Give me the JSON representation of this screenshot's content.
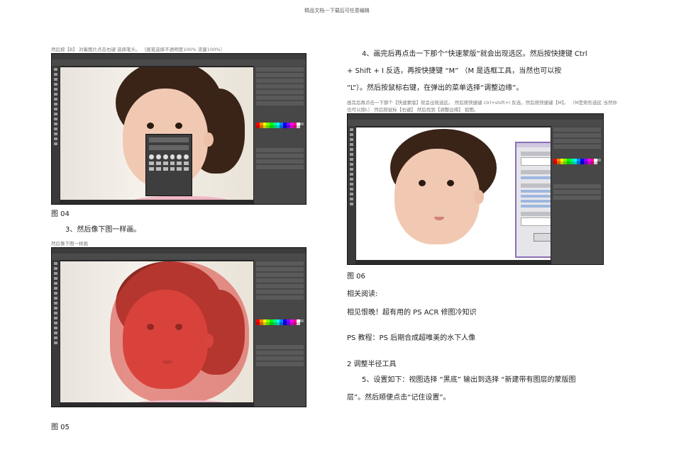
{
  "header_note": "精品文档---下载后可任意编辑",
  "fig04": {
    "caption": "然后按【B】 对着图片点击右键 选择笔头。 （画笔选择不透明度100% 流量100%）",
    "label": "图 04"
  },
  "step3": {
    "text": "3、然后像下图一样画。"
  },
  "fig05": {
    "caption": "然后像下图一样画",
    "label": "图 05"
  },
  "step4": {
    "line1": "4、画完后再点击一下那个“快速蒙版”就会出现选区。然后按快捷键 Ctrl",
    "line2": "+ Shift + I 反选，再按快捷键 “M” （M 是选框工具，当然也可以按",
    "line3": "“L”）。然后按鼠标右键，在弹出的菜单选择“调整边缘”。"
  },
  "fig06": {
    "caption_line1": "画完后再点击一下那个【快速蒙版】就会出现选区。 然后按快捷键 ctrl+shift+I 反选，然后按快捷键【M】。 （M是矩形选区 当然你",
    "caption_line2": "也可以按L） 然后按鼠标【右键】 然后找到【调整边缘】 如图。",
    "label": "图 06"
  },
  "related": {
    "heading": "相关阅读:",
    "links": [
      "相见恨晚！超有用的 PS ACR 修图冷知识",
      "PS 教程：PS 后期合成超唯美的水下人像"
    ]
  },
  "section2": {
    "title": "2 调整半径工具"
  },
  "step5": {
    "line1": "5、设置如下：视图选择 “黑底” 输出到选择 “新建带有图层的蒙版图",
    "line2": "层”。然后顺便点击“记住设置”。"
  },
  "colors": {
    "ps_bg": "#2b2b2b",
    "mask_red": "#d9403a",
    "dialog_bg": "#e6e6ea"
  }
}
